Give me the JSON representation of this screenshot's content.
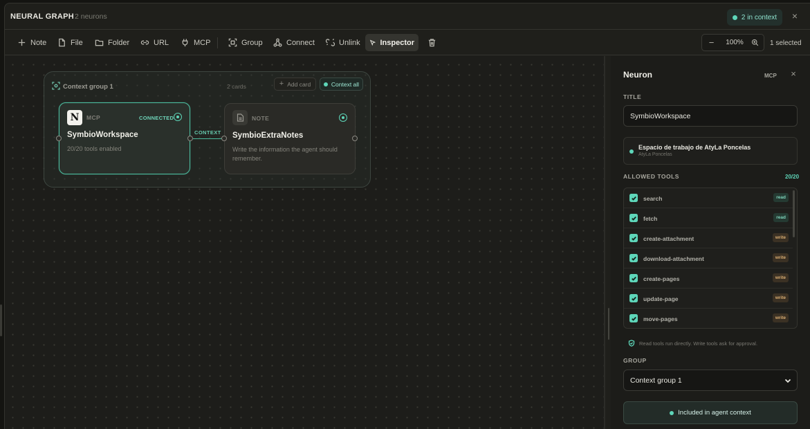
{
  "header": {
    "title": "NEURAL GRAPH",
    "neuron_count": "2 neurons",
    "context_pill": "2 in context",
    "close_icon": "×"
  },
  "toolbar": {
    "note": "Note",
    "file": "File",
    "folder": "Folder",
    "url": "URL",
    "mcp": "MCP",
    "group": "Group",
    "connect": "Connect",
    "unlink": "Unlink",
    "inspector": "Inspector",
    "zoom": "100%",
    "zoom_out": "−",
    "selected": "1 selected"
  },
  "canvas": {
    "group": {
      "title": "Context group 1",
      "count": "2 cards",
      "add_card": "Add card",
      "context_all": "Context all"
    },
    "cards": [
      {
        "kind": "MCP",
        "status": "CONNECTED",
        "title": "SymbioWorkspace",
        "subtitle": "20/20 tools enabled",
        "logo": "N"
      },
      {
        "kind": "NOTE",
        "title": "SymbioExtraNotes",
        "subtitle": "Write the information the agent should remember."
      }
    ],
    "edge_label": "CONTEXT"
  },
  "inspector": {
    "title": "Neuron",
    "badge": "MCP",
    "title_label": "TITLE",
    "title_value": "SymbioWorkspace",
    "workspace_name": "Espacio de trabajo de AtyLa Poncelas",
    "workspace_owner": "AtyLa Poncelas",
    "tools_label": "ALLOWED TOOLS",
    "tools_count": "20/20",
    "tools": [
      {
        "name": "search",
        "mode": "read",
        "checked": true
      },
      {
        "name": "fetch",
        "mode": "read",
        "checked": true
      },
      {
        "name": "create-attachment",
        "mode": "write",
        "checked": true
      },
      {
        "name": "download-attachment",
        "mode": "write",
        "checked": true
      },
      {
        "name": "create-pages",
        "mode": "write",
        "checked": true
      },
      {
        "name": "update-page",
        "mode": "write",
        "checked": true
      },
      {
        "name": "move-pages",
        "mode": "write",
        "checked": true
      }
    ],
    "hint": "Read tools run directly. Write tools ask for approval.",
    "group_label": "GROUP",
    "group_value": "Context group 1",
    "context_button": "Included in agent context"
  },
  "colors": {
    "accent": "#5ed6b9",
    "background": "#1f1f1b",
    "read_tag": "#7fd4bb",
    "write_tag": "#d8ad72"
  }
}
